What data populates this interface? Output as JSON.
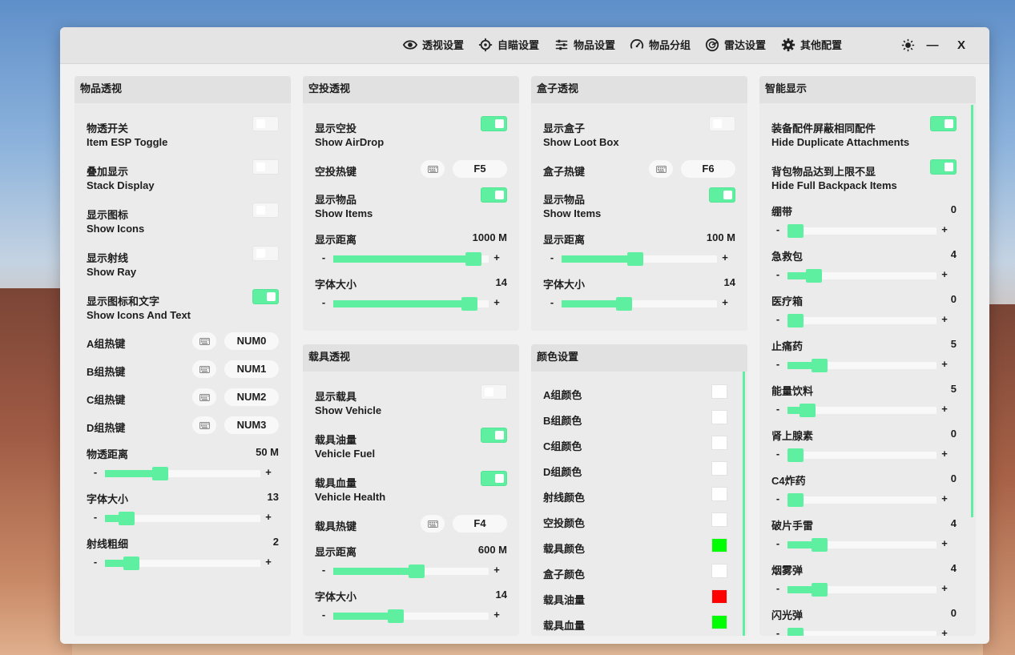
{
  "nav": [
    {
      "label": "透视设置",
      "icon": "eye-icon"
    },
    {
      "label": "自瞄设置",
      "icon": "crosshair-icon"
    },
    {
      "label": "物品设置",
      "icon": "sliders-icon"
    },
    {
      "label": "物品分组",
      "icon": "gauge-icon"
    },
    {
      "label": "雷达设置",
      "icon": "radar-icon"
    },
    {
      "label": "其他配置",
      "icon": "gear-icon"
    }
  ],
  "window": {
    "theme_icon": "sun-icon",
    "minimize": "—",
    "close": "X"
  },
  "colors": {
    "accent": "#5ef0a0",
    "green_swatch": "#00ff00",
    "red_swatch": "#ff0000",
    "white_swatch": "#ffffff"
  },
  "item_esp": {
    "title": "物品透视",
    "toggles": [
      {
        "cn": "物透开关",
        "en": "Item ESP Toggle",
        "on": false
      },
      {
        "cn": "叠加显示",
        "en": "Stack Display",
        "on": false
      },
      {
        "cn": "显示图标",
        "en": "Show Icons",
        "on": false
      },
      {
        "cn": "显示射线",
        "en": "Show Ray",
        "on": false
      },
      {
        "cn": "显示图标和文字",
        "en": "Show Icons And Text",
        "on": true
      }
    ],
    "hotkeys": [
      {
        "label": "A组热键",
        "key": "NUM0"
      },
      {
        "label": "B组热键",
        "key": "NUM1"
      },
      {
        "label": "C组热键",
        "key": "NUM2"
      },
      {
        "label": "D组热键",
        "key": "NUM3"
      }
    ],
    "sliders": [
      {
        "label": "物透距离",
        "value": "50 M",
        "fraction": 0.34
      },
      {
        "label": "字体大小",
        "value": "13",
        "fraction": 0.1
      },
      {
        "label": "射线粗细",
        "value": "2",
        "fraction": 0.13
      }
    ],
    "minus": "-",
    "plus": "+"
  },
  "airdrop_esp": {
    "title": "空投透视",
    "toggles": [
      {
        "cn": "显示空投",
        "en": "Show AirDrop",
        "on": true
      },
      {
        "cn": "显示物品",
        "en": "Show Items",
        "on": true
      }
    ],
    "hotkey": {
      "label": "空投热键",
      "key": "F5"
    },
    "sliders": [
      {
        "label": "显示距离",
        "value": "1000 M",
        "fraction": 0.95
      },
      {
        "label": "字体大小",
        "value": "14",
        "fraction": 0.92
      }
    ],
    "minus": "-",
    "plus": "+"
  },
  "box_esp": {
    "title": "盒子透视",
    "toggles": [
      {
        "cn": "显示盒子",
        "en": "Show Loot Box",
        "on": false
      },
      {
        "cn": "显示物品",
        "en": "Show Items",
        "on": true
      }
    ],
    "hotkey": {
      "label": "盒子热键",
      "key": "F6"
    },
    "sliders": [
      {
        "label": "显示距离",
        "value": "100 M",
        "fraction": 0.47
      },
      {
        "label": "字体大小",
        "value": "14",
        "fraction": 0.39
      }
    ],
    "minus": "-",
    "plus": "+"
  },
  "vehicle_esp": {
    "title": "载具透视",
    "toggles": [
      {
        "cn": "显示载具",
        "en": "Show Vehicle",
        "on": false
      },
      {
        "cn": "载具油量",
        "en": "Vehicle Fuel",
        "on": true
      },
      {
        "cn": "载具血量",
        "en": "Vehicle Health",
        "on": true
      }
    ],
    "hotkey": {
      "label": "载具热键",
      "key": "F4"
    },
    "sliders": [
      {
        "label": "显示距离",
        "value": "600 M",
        "fraction": 0.54
      },
      {
        "label": "字体大小",
        "value": "14",
        "fraction": 0.39
      }
    ],
    "minus": "-",
    "plus": "+"
  },
  "color_settings": {
    "title": "颜色设置",
    "items": [
      {
        "label": "A组颜色",
        "color": "#ffffff"
      },
      {
        "label": "B组颜色",
        "color": "#ffffff"
      },
      {
        "label": "C组颜色",
        "color": "#ffffff"
      },
      {
        "label": "D组颜色",
        "color": "#ffffff"
      },
      {
        "label": "射线颜色",
        "color": "#ffffff"
      },
      {
        "label": "空投颜色",
        "color": "#ffffff"
      },
      {
        "label": "载具颜色",
        "color": "#00ff00"
      },
      {
        "label": "盒子颜色",
        "color": "#ffffff"
      },
      {
        "label": "载具油量",
        "color": "#ff0000"
      },
      {
        "label": "载具血量",
        "color": "#00ff00"
      }
    ]
  },
  "smart_display": {
    "title": "智能显示",
    "toggles": [
      {
        "cn": "装备配件屏蔽相同配件",
        "en": "Hide Duplicate Attachments",
        "on": true
      },
      {
        "cn": "背包物品达到上限不显",
        "en": "Hide Full Backpack Items",
        "on": true
      }
    ],
    "sliders": [
      {
        "label": "绷带",
        "value": "0",
        "fraction": 0.0
      },
      {
        "label": "急救包",
        "value": "4",
        "fraction": 0.14
      },
      {
        "label": "医疗箱",
        "value": "0",
        "fraction": 0.0
      },
      {
        "label": "止痛药",
        "value": "5",
        "fraction": 0.18
      },
      {
        "label": "能量饮料",
        "value": "5",
        "fraction": 0.09
      },
      {
        "label": "肾上腺素",
        "value": "0",
        "fraction": 0.0
      },
      {
        "label": "C4炸药",
        "value": "0",
        "fraction": 0.0
      },
      {
        "label": "破片手雷",
        "value": "4",
        "fraction": 0.18
      },
      {
        "label": "烟雾弹",
        "value": "4",
        "fraction": 0.18
      },
      {
        "label": "闪光弹",
        "value": "0",
        "fraction": 0.0
      }
    ],
    "minus": "-",
    "plus": "+"
  }
}
